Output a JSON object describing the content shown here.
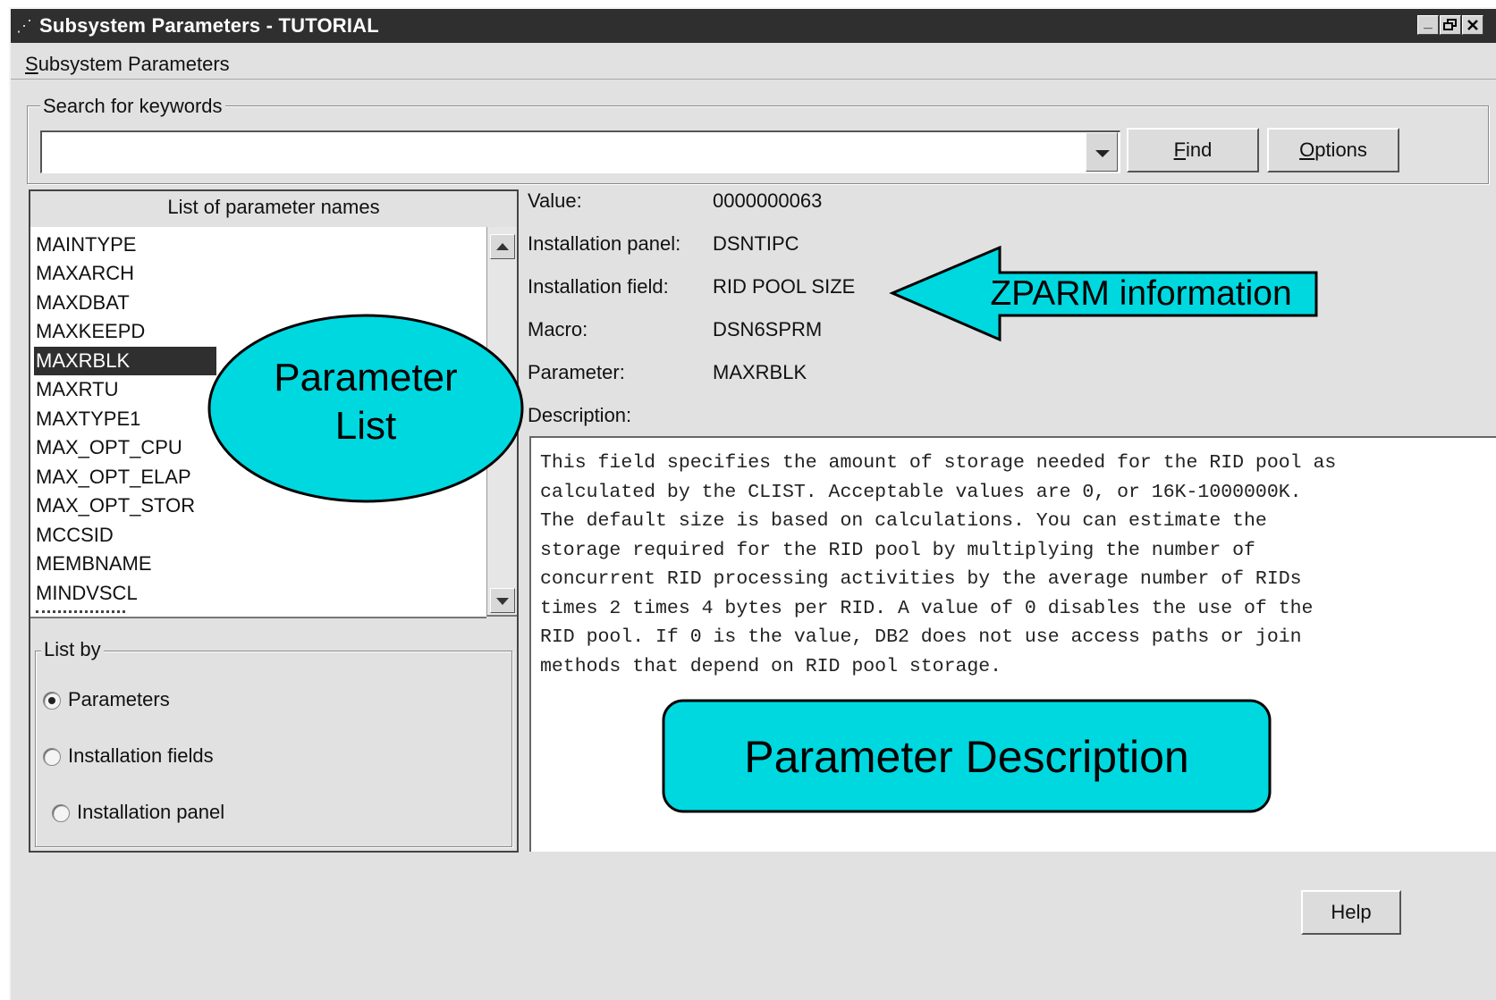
{
  "window": {
    "title": "Subsystem Parameters - TUTORIAL",
    "controls": {
      "minimize": "_",
      "restore": "🗗",
      "close": "✕"
    }
  },
  "menu": {
    "subsystem_first": "S",
    "subsystem_rest": "ubsystem Parameters"
  },
  "search": {
    "group_label": "Search for keywords",
    "value": "",
    "find_first": "F",
    "find_rest": "ind",
    "options_first": "O",
    "options_rest": "ptions"
  },
  "parameter_list": {
    "header": "List of parameter names",
    "items": [
      "MAINTYPE",
      "MAXARCH",
      "MAXDBAT",
      "MAXKEEPD",
      "MAXRBLK",
      "MAXRTU",
      "MAXTYPE1",
      "MAX_OPT_CPU",
      "MAX_OPT_ELAP",
      "MAX_OPT_STOR",
      "MCCSID",
      "MEMBNAME",
      "MINDVSCL"
    ],
    "selected": "MAXRBLK"
  },
  "list_by": {
    "label": "List by",
    "options": [
      "Parameters",
      "Installation fields",
      "Installation panel"
    ],
    "selected": "Parameters"
  },
  "details": {
    "value_label": "Value:",
    "value": "0000000063",
    "panel_label": "Installation panel:",
    "panel": "DSNTIPC",
    "field_label": "Installation field:",
    "field": "RID POOL SIZE",
    "macro_label": "Macro:",
    "macro": "DSN6SPRM",
    "parameter_label": "Parameter:",
    "parameter": "MAXRBLK",
    "description_label": "Description:",
    "description": "This field specifies the amount of storage needed for the RID pool as\ncalculated by the CLIST. Acceptable values are 0, or 16K-1000000K.\nThe default size is based on calculations. You can estimate the\nstorage required for the RID pool by multiplying the number of\nconcurrent RID processing activities by the average number of RIDs\ntimes 2 times 4 bytes per RID. A value of 0 disables the use of the\nRID pool. If 0 is the value, DB2 does not use access paths or join\nmethods that depend on RID pool storage."
  },
  "help_label": "Help",
  "annotations": {
    "parameter_list_line1": "Parameter",
    "parameter_list_line2": "List",
    "zparm_info": "ZPARM information",
    "parameter_description": "Parameter Description",
    "fill_color": "#00d8e0"
  }
}
